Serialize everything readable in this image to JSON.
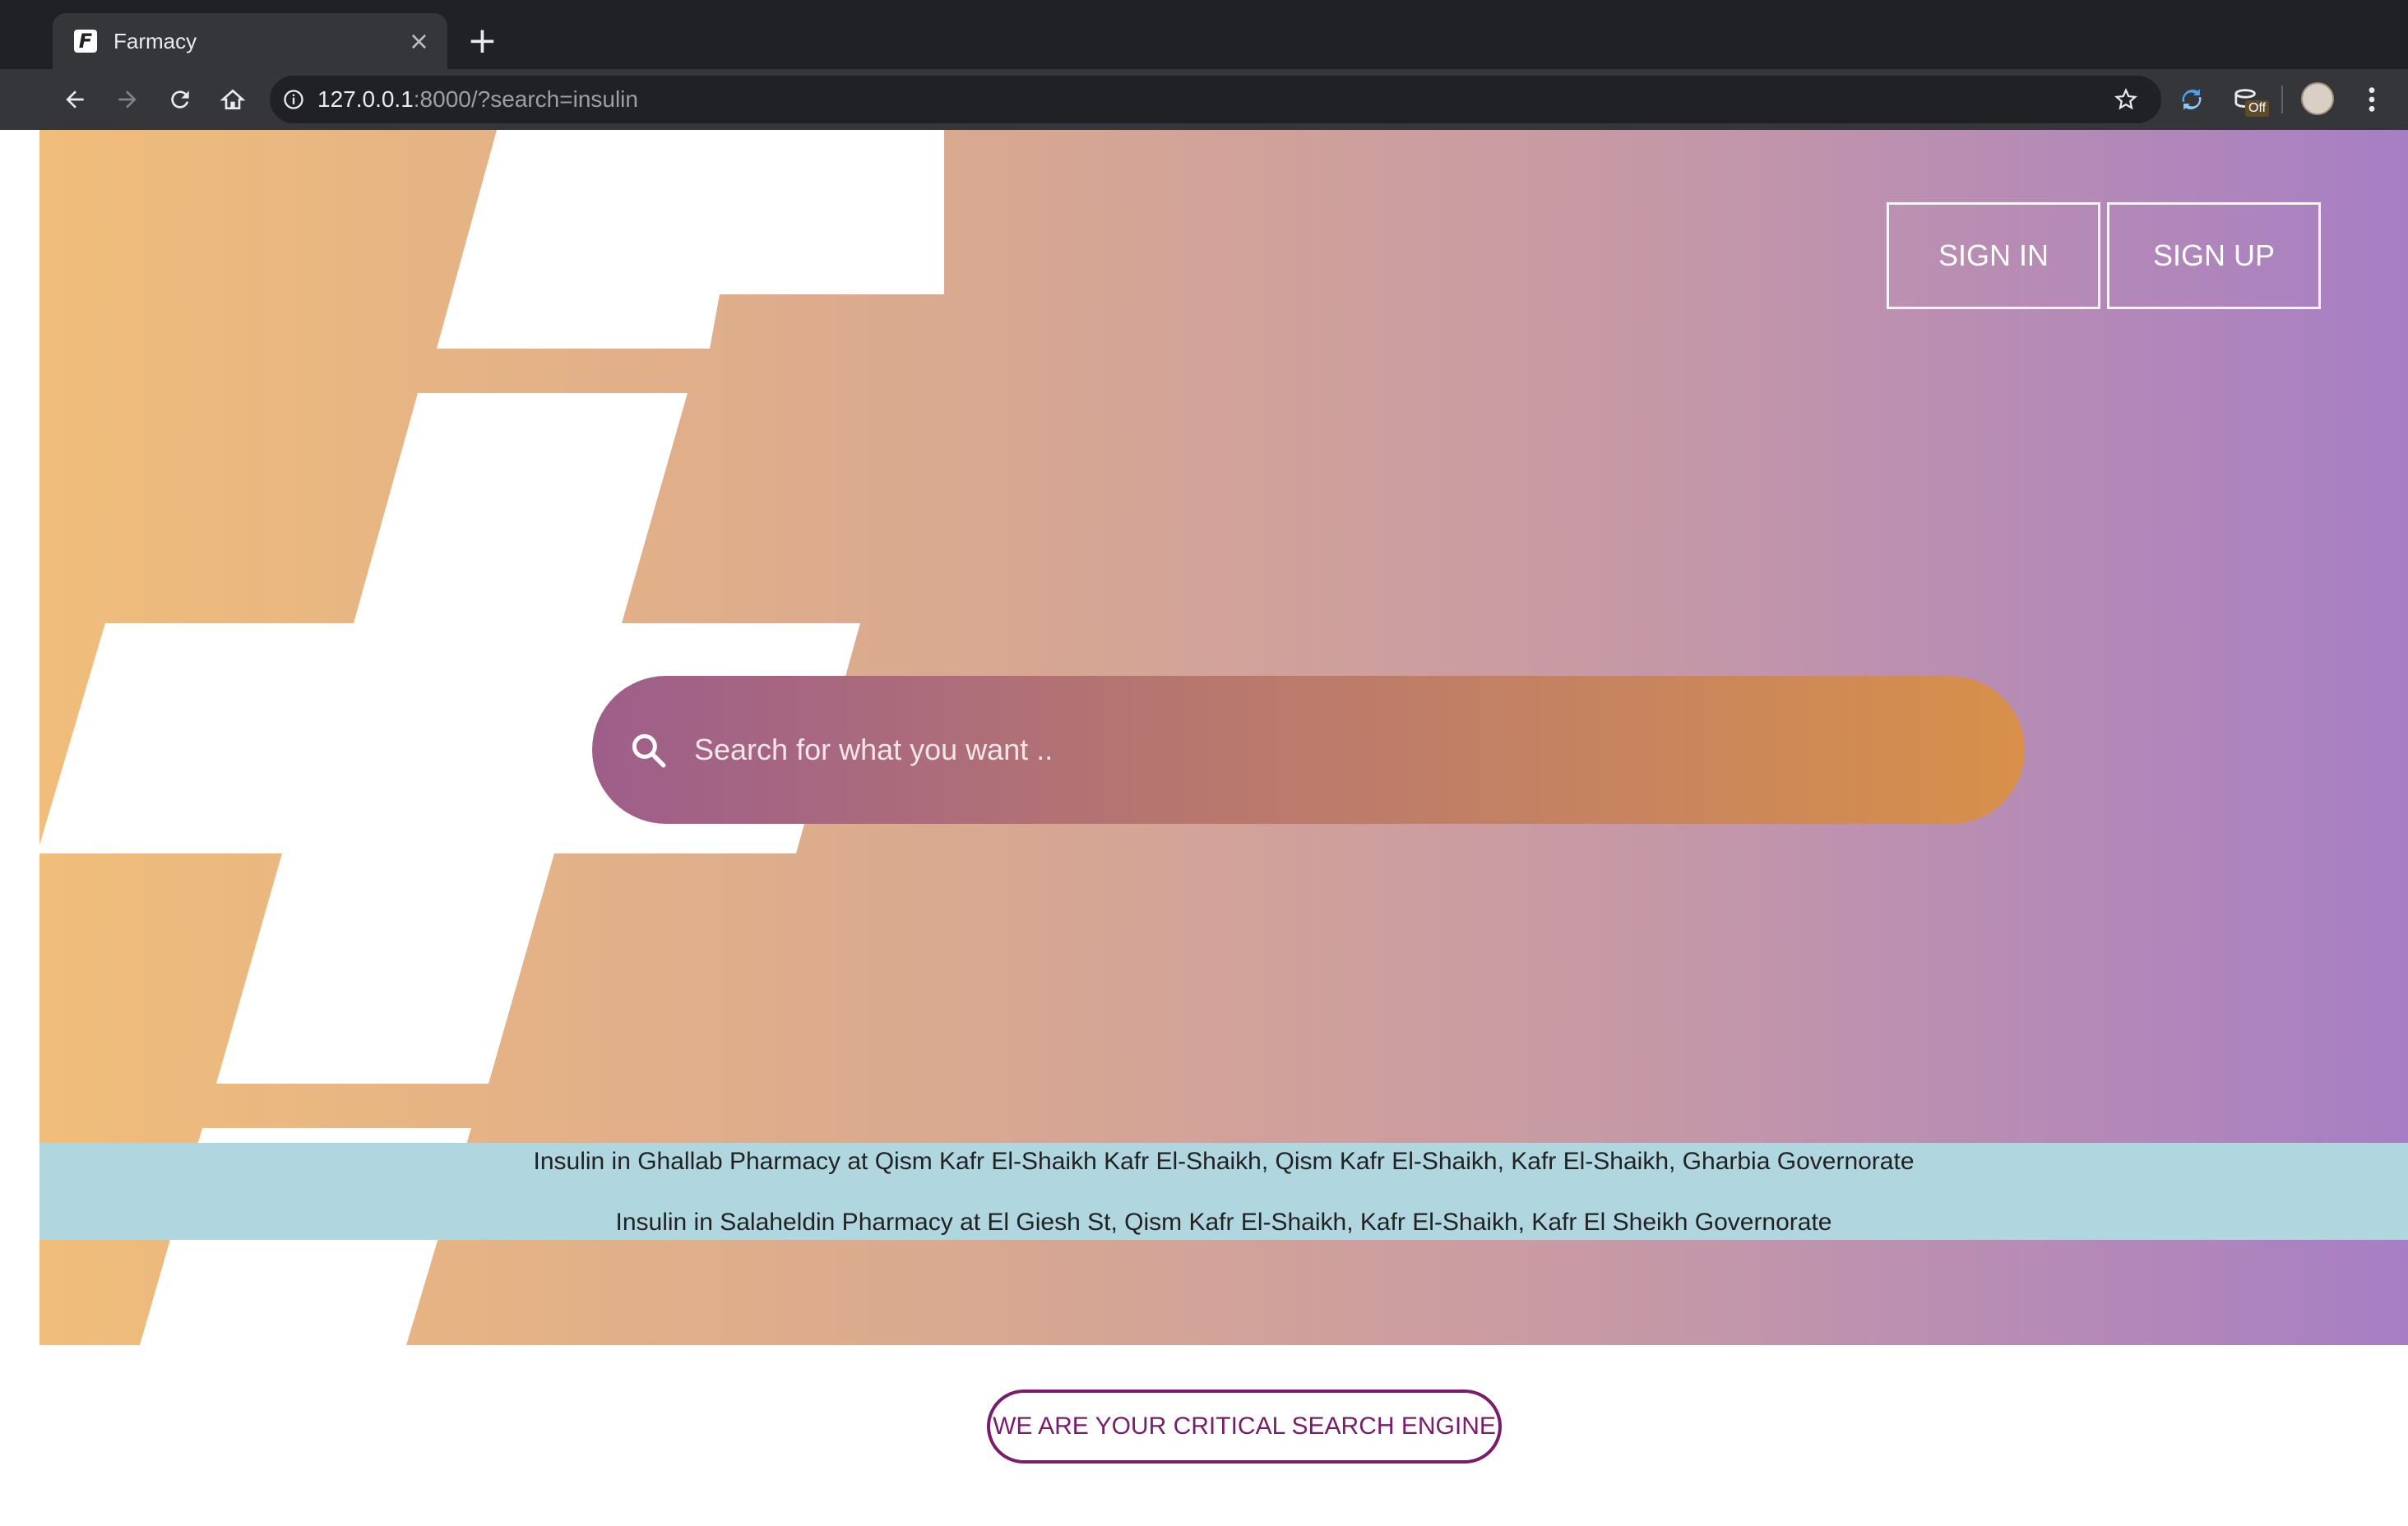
{
  "browser": {
    "tab_title": "Farmacy",
    "tab_favicon_glyph": "F",
    "close_glyph": "×",
    "new_tab_glyph": "+",
    "url_host": "127.0.0.1",
    "url_rest": ":8000/?search=insulin",
    "extension_badge": "Off",
    "icons": [
      "back-icon",
      "forward-icon",
      "reload-icon",
      "home-icon",
      "info-icon",
      "star-icon",
      "sync-extension-icon",
      "stack-extension-icon",
      "profile-avatar",
      "menu-icon"
    ]
  },
  "header": {
    "sign_in": "SIGN IN",
    "sign_up": "SIGN UP"
  },
  "search": {
    "placeholder": "Search for what you want .."
  },
  "results": [
    "Insulin in Ghallab Pharmacy at Qism Kafr El-Shaikh Kafr El-Shaikh, Qism Kafr El-Shaikh, Kafr El-Shaikh, Gharbia Governorate",
    "Insulin in Salaheldin Pharmacy at El Giesh St, Qism Kafr El-Shaikh, Kafr El-Shaikh, Kafr El Sheikh Governorate"
  ],
  "footer": {
    "tagline": "WE ARE YOUR CRITICAL SEARCH ENGINE"
  },
  "colors": {
    "gradient_start": "#f0bd7a",
    "gradient_end": "#a77ec4",
    "results_band": "#b0d6e0",
    "brand_purple": "#7a1c6c"
  }
}
